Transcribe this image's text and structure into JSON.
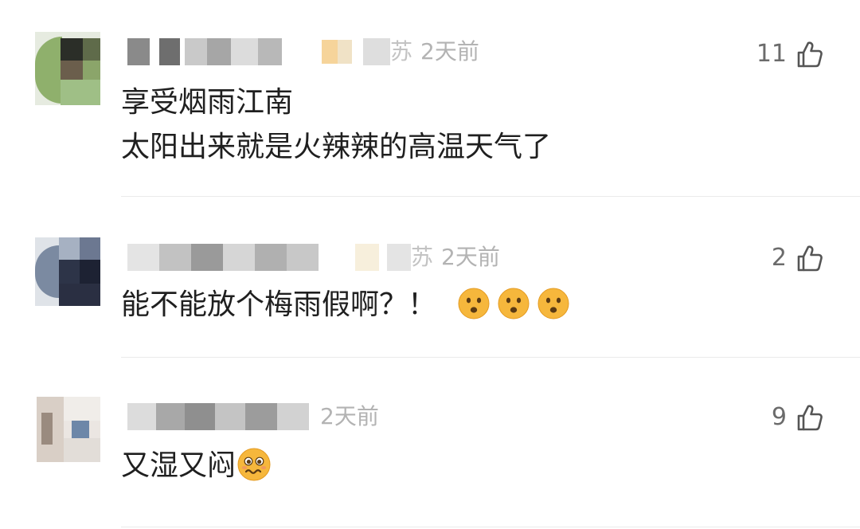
{
  "comments": [
    {
      "location_fragment": "苏",
      "time": "2天前",
      "likes": "11",
      "lines": [
        "享受烟雨江南",
        "太阳出来就是火辣辣的高温天气了"
      ]
    },
    {
      "location_fragment": "苏",
      "time": "2天前",
      "likes": "2",
      "text": "能不能放个梅雨假啊？！",
      "emojis": [
        "frowning-face-emoji",
        "frowning-face-emoji",
        "frowning-face-emoji"
      ]
    },
    {
      "time": "2天前",
      "likes": "9",
      "text": "又湿又闷",
      "emojis": [
        "woozy-face-emoji"
      ]
    }
  ],
  "colors": {
    "body_text": "#1f1f1f",
    "meta_text": "#b3b3b3",
    "like_text": "#6b6b6b",
    "divider": "#eaeaea",
    "emoji_yellow": "#f6b73c"
  },
  "icons": [
    "thumbs-up-icon",
    "avatar-image",
    "blurred-username"
  ]
}
